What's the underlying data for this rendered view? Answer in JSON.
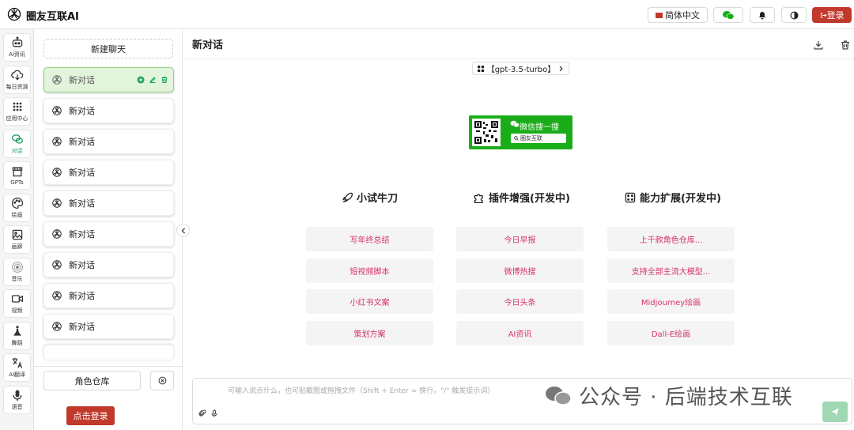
{
  "app": {
    "brand": "圈友互联AI"
  },
  "topbar": {
    "lang_label": "简体中文",
    "login_label": "登录",
    "colors": {
      "brand_red": "#c0392b",
      "wechat_green": "#1aad19"
    }
  },
  "nav": [
    {
      "label": "AI资讯",
      "icon": "robot-icon"
    },
    {
      "label": "每日资源",
      "icon": "cloud-download-icon"
    },
    {
      "label": "应用中心",
      "icon": "grid-icon"
    },
    {
      "label": "对话",
      "icon": "chat-bubbles-icon",
      "active": true
    },
    {
      "label": "GPTs",
      "icon": "store-icon"
    },
    {
      "label": "绘画",
      "icon": "palette-icon"
    },
    {
      "label": "画廊",
      "icon": "image-icon"
    },
    {
      "label": "音乐",
      "icon": "music-disc-icon"
    },
    {
      "label": "视频",
      "icon": "video-camera-icon"
    },
    {
      "label": "舞蹈",
      "icon": "dancer-icon"
    },
    {
      "label": "AI翻译",
      "icon": "translate-icon"
    },
    {
      "label": "语音",
      "icon": "microphone-icon"
    }
  ],
  "chatlist": {
    "new_chat_label": "新建聊天",
    "items": [
      {
        "label": "新对话"
      },
      {
        "label": "新对话"
      },
      {
        "label": "新对话"
      },
      {
        "label": "新对话"
      },
      {
        "label": "新对话"
      },
      {
        "label": "新对话"
      },
      {
        "label": "新对话"
      },
      {
        "label": "新对话"
      },
      {
        "label": "新对话"
      }
    ],
    "role_library_label": "角色仓库",
    "login_label": "点击登录"
  },
  "main": {
    "title": "新对话",
    "model_label": "【gpt-3.5-turbo】",
    "wechat_card": {
      "title": "微信搜一搜",
      "search_text": "圈友互联"
    },
    "columns": [
      {
        "title": "小试牛刀",
        "icon": "rocket-icon",
        "prompts": [
          "写年终总结",
          "短视频脚本",
          "小红书文案",
          "策划方案"
        ]
      },
      {
        "title": "插件增强(开发中)",
        "icon": "puzzle-icon",
        "prompts": [
          "今日早报",
          "微博热搜",
          "今日头条",
          "AI资讯"
        ]
      },
      {
        "title": "能力扩展(开发中)",
        "icon": "dice-icon",
        "prompts": [
          "上千款角色仓库...",
          "支持全部主流大模型...",
          "Midjourney绘画",
          "Dall-E绘画"
        ]
      }
    ],
    "input_placeholder": "可输入说点什么，也可贴截图或拖拽文件（Shift + Enter = 换行，\"/\" 触发提示词）",
    "watermark": "公众号 · 后端技术互联"
  }
}
